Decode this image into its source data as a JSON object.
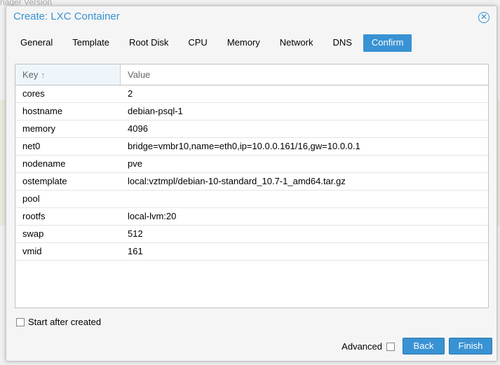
{
  "background": {
    "fragment_text": "nager Version"
  },
  "window": {
    "title": "Create: LXC Container",
    "close_icon": "close-icon"
  },
  "tabs": [
    {
      "label": "General",
      "active": false
    },
    {
      "label": "Template",
      "active": false
    },
    {
      "label": "Root Disk",
      "active": false
    },
    {
      "label": "CPU",
      "active": false
    },
    {
      "label": "Memory",
      "active": false
    },
    {
      "label": "Network",
      "active": false
    },
    {
      "label": "DNS",
      "active": false
    },
    {
      "label": "Confirm",
      "active": true
    }
  ],
  "grid": {
    "columns": {
      "key": "Key",
      "value": "Value",
      "sort_icon": "↑"
    },
    "rows": [
      {
        "key": "cores",
        "value": "2"
      },
      {
        "key": "hostname",
        "value": "debian-psql-1"
      },
      {
        "key": "memory",
        "value": "4096"
      },
      {
        "key": "net0",
        "value": "bridge=vmbr10,name=eth0,ip=10.0.0.161/16,gw=10.0.0.1"
      },
      {
        "key": "nodename",
        "value": "pve"
      },
      {
        "key": "ostemplate",
        "value": "local:vztmpl/debian-10-standard_10.7-1_amd64.tar.gz"
      },
      {
        "key": "pool",
        "value": ""
      },
      {
        "key": "rootfs",
        "value": "local-lvm:20"
      },
      {
        "key": "swap",
        "value": "512"
      },
      {
        "key": "vmid",
        "value": "161"
      }
    ]
  },
  "start_after_created": {
    "label": "Start after created",
    "checked": false
  },
  "footer": {
    "advanced_label": "Advanced",
    "advanced_checked": false,
    "back_label": "Back",
    "finish_label": "Finish"
  },
  "colors": {
    "accent": "#3892d3"
  }
}
